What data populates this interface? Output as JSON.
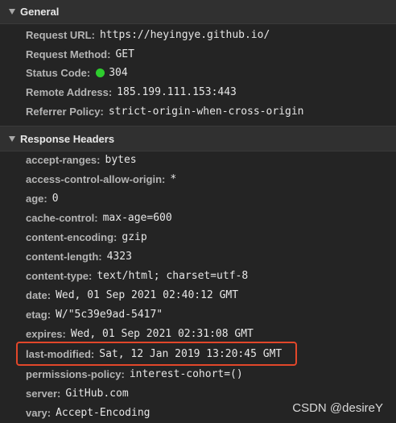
{
  "general": {
    "title": "General",
    "rows": [
      {
        "key": "Request URL",
        "value": "https://heyingye.github.io/"
      },
      {
        "key": "Request Method",
        "value": "GET"
      },
      {
        "key": "Status Code",
        "value": "304"
      },
      {
        "key": "Remote Address",
        "value": "185.199.111.153:443"
      },
      {
        "key": "Referrer Policy",
        "value": "strict-origin-when-cross-origin"
      }
    ]
  },
  "response_headers": {
    "title": "Response Headers",
    "rows": [
      {
        "key": "accept-ranges",
        "value": "bytes"
      },
      {
        "key": "access-control-allow-origin",
        "value": "*"
      },
      {
        "key": "age",
        "value": "0"
      },
      {
        "key": "cache-control",
        "value": "max-age=600"
      },
      {
        "key": "content-encoding",
        "value": "gzip"
      },
      {
        "key": "content-length",
        "value": "4323"
      },
      {
        "key": "content-type",
        "value": "text/html; charset=utf-8"
      },
      {
        "key": "date",
        "value": "Wed, 01 Sep 2021 02:40:12 GMT"
      },
      {
        "key": "etag",
        "value": "W/\"5c39e9ad-5417\""
      },
      {
        "key": "expires",
        "value": "Wed, 01 Sep 2021 02:31:08 GMT"
      },
      {
        "key": "last-modified",
        "value": "Sat, 12 Jan 2019 13:20:45 GMT"
      },
      {
        "key": "permissions-policy",
        "value": "interest-cohort=()"
      },
      {
        "key": "server",
        "value": "GitHub.com"
      },
      {
        "key": "vary",
        "value": "Accept-Encoding"
      }
    ]
  },
  "colors": {
    "status_ok": "#2ecc2e",
    "highlight_border": "#e2472a"
  },
  "icons": {
    "section_toggle": "triangle-down-icon",
    "status": "green-dot-icon"
  },
  "watermark": "CSDN @desireY"
}
